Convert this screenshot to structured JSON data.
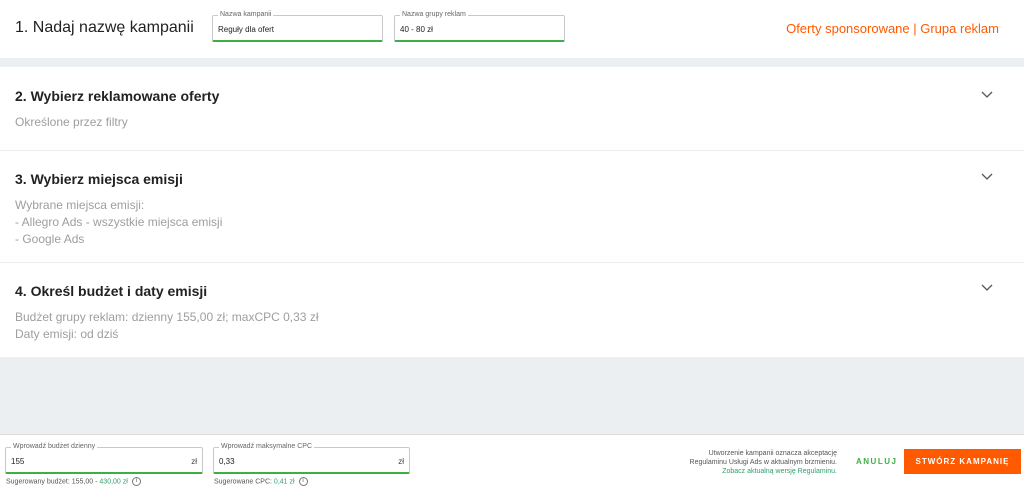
{
  "step1": {
    "title": "1. Nadaj nazwę kampanii",
    "campaign_name": {
      "legend": "Nazwa kampanii",
      "value": "Reguły dla ofert"
    },
    "group_name": {
      "legend": "Nazwa grupy reklam",
      "value": "40 - 80 zł"
    },
    "header_link": "Oferty sponsorowane | Grupa reklam"
  },
  "sections": [
    {
      "title": "2. Wybierz reklamowane oferty",
      "lines": [
        "Określone przez filtry"
      ]
    },
    {
      "title": "3. Wybierz miejsca emisji",
      "lines": [
        "Wybrane miejsca emisji:",
        "- Allegro Ads - wszystkie miejsca emisji",
        "- Google Ads"
      ]
    },
    {
      "title": "4. Określ budżet i daty emisji",
      "lines": [
        "Budżet grupy reklam: dzienny 155,00 zł; maxCPC 0,33 zł",
        "Daty emisji: od dziś"
      ]
    }
  ],
  "footer": {
    "budget": {
      "legend": "Wprowadź budżet dzienny",
      "value": "155",
      "unit": "zł",
      "hint_prefix": "Sugerowany budżet: 155,00 - ",
      "hint_value": "430,00 zł"
    },
    "cpc": {
      "legend": "Wprowadź maksymalne CPC",
      "value": "0,33",
      "unit": "zł",
      "hint_prefix": "Sugerowane CPC: ",
      "hint_value": "0,41 zł"
    },
    "terms_line1": "Utworzenie kampanii oznacza akceptację",
    "terms_line2": "Regulaminu Usługi Ads w aktualnym brzmieniu.",
    "terms_link": "Zobacz aktualną wersję Regulaminu.",
    "cancel_label": "ANULUJ",
    "create_label": "STWÓRZ KAMPANIĘ",
    "info_icon": "i"
  },
  "colors": {
    "accent": "#ff5a00",
    "valid": "#3cb043",
    "link": "#2f9e6e"
  },
  "icons": {
    "chevron": "chevron-down-icon",
    "info": "info-icon"
  }
}
